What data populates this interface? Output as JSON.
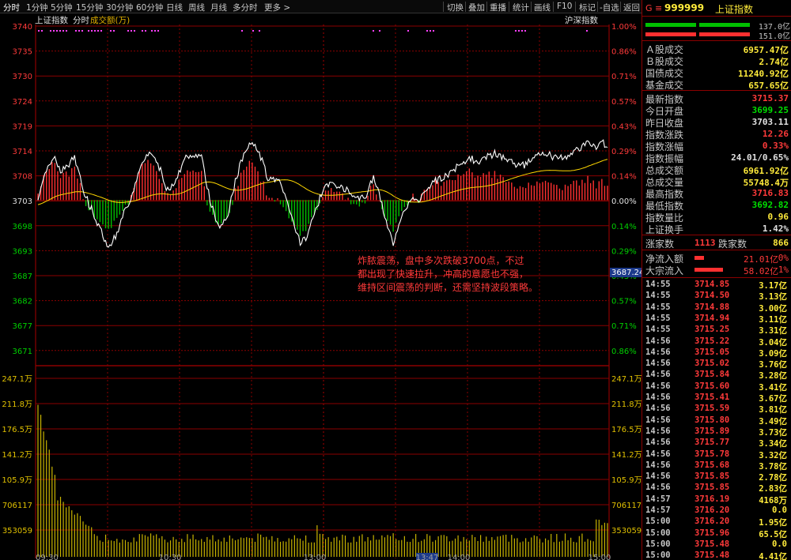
{
  "toolbar": {
    "periods": [
      "分时",
      "1分钟",
      "5分钟",
      "15分钟",
      "30分钟",
      "60分钟",
      "日线",
      "周线",
      "月线",
      "多分时",
      "更多 >"
    ],
    "actions": [
      "切换",
      "叠加",
      "重播",
      "统计",
      "画线",
      "F10",
      "标记",
      "-自选",
      "返回"
    ]
  },
  "chart": {
    "subtitle_index": "上证指数",
    "subtitle_mode": "分时",
    "subtitle_metric": "成交额(万)",
    "right_label": "沪深指数",
    "current_price_tag": "3687.24",
    "price_labels": [
      "3740",
      "3735",
      "3730",
      "3724",
      "3719",
      "3714",
      "3708",
      "3703",
      "3698",
      "3693",
      "3687",
      "3682",
      "3677",
      "3671"
    ],
    "pct_labels": [
      "1.00%",
      "0.86%",
      "0.71%",
      "0.57%",
      "0.43%",
      "0.29%",
      "0.14%",
      "0.00%",
      "0.14%",
      "0.29%",
      "0.43%",
      "0.57%",
      "0.71%",
      "0.86%"
    ],
    "volume_labels": [
      "247.1万",
      "211.8万",
      "176.5万",
      "141.2万",
      "105.9万",
      "706117",
      "353059"
    ],
    "time_labels": [
      "09:30",
      "10:30",
      "13:00",
      "13:47",
      "14:00",
      "15:00"
    ],
    "colors": {
      "up": "#ff3030",
      "down": "#00c000",
      "white_line": "#ffffff",
      "yellow_line": "#ffd700",
      "grid": "#8b0000",
      "volume": "#c8b400"
    }
  },
  "annotation": {
    "lines": [
      "炸脓震荡，盘中多次跌破3700点，不过",
      "都出现了快速拉升，冲高的意愿也不强，",
      "维持区间震荡的判断，还需坚持波段策略。"
    ]
  },
  "panel": {
    "g": "G",
    "menu_icon": "≡",
    "code": "999999",
    "name": "上证指数",
    "bars": [
      {
        "value": "137.0亿",
        "color": "#00c000"
      },
      {
        "value": "151.0亿",
        "color": "#ff3030"
      }
    ],
    "turnover": [
      {
        "label": "Ａ股成交",
        "value": "6957.47亿"
      },
      {
        "label": "Ｂ股成交",
        "value": "2.74亿"
      },
      {
        "label": "国债成交",
        "value": "11240.92亿"
      },
      {
        "label": "基金成交",
        "value": "657.65亿"
      }
    ],
    "stats": [
      {
        "label": "最新指数",
        "value": "3715.37",
        "color": "#ff3a3a"
      },
      {
        "label": "今日开盘",
        "value": "3699.25",
        "color": "#00e000"
      },
      {
        "label": "昨日收盘",
        "value": "3703.11",
        "color": "#e0e0e0"
      },
      {
        "label": "指数涨跌",
        "value": "12.26",
        "color": "#ff3a3a"
      },
      {
        "label": "指数涨幅",
        "value": "0.33%",
        "color": "#ff3a3a"
      },
      {
        "label": "指数振幅",
        "value": "24.01/0.65%",
        "color": "#e0e0e0"
      },
      {
        "label": "总成交额",
        "value": "6961.92亿",
        "color": "#ffeb3b"
      },
      {
        "label": "总成交量",
        "value": "55748.4万",
        "color": "#ffeb3b"
      },
      {
        "label": "最高指数",
        "value": "3716.83",
        "color": "#ff3a3a"
      },
      {
        "label": "最低指数",
        "value": "3692.82",
        "color": "#00e000"
      },
      {
        "label": "指数量比",
        "value": "0.96",
        "color": "#ffeb3b"
      },
      {
        "label": "上证换手",
        "value": "1.42%",
        "color": "#e0e0e0"
      }
    ],
    "breadth": {
      "up_label": "涨家数",
      "up_value": "1113",
      "down_label": "跌家数",
      "down_value": "866"
    },
    "flows": [
      {
        "label": "净流入额",
        "value": "21.01亿",
        "pct": "0%",
        "bar": 0.3
      },
      {
        "label": "大宗流入",
        "value": "58.02亿",
        "pct": "1%",
        "bar": 0.9
      }
    ],
    "ticks": [
      {
        "time": "14:55",
        "price": "3714.85",
        "vol": "3.17亿"
      },
      {
        "time": "14:55",
        "price": "3714.50",
        "vol": "3.13亿"
      },
      {
        "time": "14:55",
        "price": "3714.88",
        "vol": "3.00亿"
      },
      {
        "time": "14:55",
        "price": "3714.94",
        "vol": "3.11亿"
      },
      {
        "time": "14:55",
        "price": "3715.25",
        "vol": "3.31亿"
      },
      {
        "time": "14:56",
        "price": "3715.22",
        "vol": "3.04亿"
      },
      {
        "time": "14:56",
        "price": "3715.05",
        "vol": "3.09亿"
      },
      {
        "time": "14:56",
        "price": "3715.02",
        "vol": "3.76亿"
      },
      {
        "time": "14:56",
        "price": "3715.84",
        "vol": "3.28亿"
      },
      {
        "time": "14:56",
        "price": "3715.60",
        "vol": "3.41亿"
      },
      {
        "time": "14:56",
        "price": "3715.41",
        "vol": "3.67亿"
      },
      {
        "time": "14:56",
        "price": "3715.59",
        "vol": "3.81亿"
      },
      {
        "time": "14:56",
        "price": "3715.80",
        "vol": "3.49亿"
      },
      {
        "time": "14:56",
        "price": "3715.89",
        "vol": "3.73亿"
      },
      {
        "time": "14:56",
        "price": "3715.77",
        "vol": "3.34亿"
      },
      {
        "time": "14:56",
        "price": "3715.78",
        "vol": "3.32亿"
      },
      {
        "time": "14:56",
        "price": "3715.68",
        "vol": "3.78亿"
      },
      {
        "time": "14:56",
        "price": "3715.85",
        "vol": "2.78亿"
      },
      {
        "time": "14:56",
        "price": "3715.85",
        "vol": "2.83亿"
      },
      {
        "time": "14:57",
        "price": "3716.19",
        "vol": "4168万"
      },
      {
        "time": "14:57",
        "price": "3716.20",
        "vol": "0.0"
      },
      {
        "time": "15:00",
        "price": "3716.20",
        "vol": "1.95亿"
      },
      {
        "time": "15:00",
        "price": "3715.96",
        "vol": "65.5亿"
      },
      {
        "time": "15:00",
        "price": "3715.48",
        "vol": "0.0"
      },
      {
        "time": "15:00",
        "price": "3715.48",
        "vol": "4.41亿"
      }
    ]
  }
}
